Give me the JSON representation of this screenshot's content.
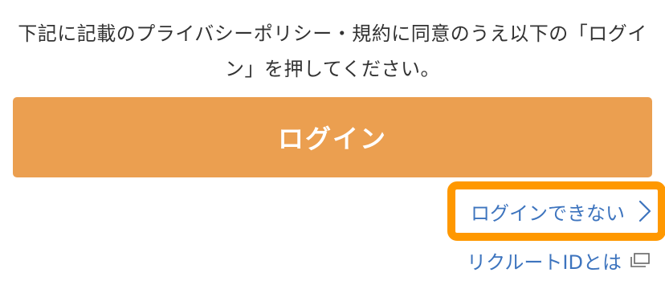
{
  "notice": {
    "line1": "下記に記載のプライバシーポリシー・規約に同意のうえ以下の「ログイ",
    "line2": "ン」を押してください。"
  },
  "login_button": {
    "label": "ログイン",
    "color": "#eb9f50"
  },
  "links": {
    "cant_login": "ログインできない",
    "cant_login_icon": "chevron-right-icon",
    "recruit_id": "リクルートIDとは",
    "recruit_id_icon": "external-window-icon",
    "link_color": "#3d74be",
    "highlight_color": "#ff9800"
  }
}
